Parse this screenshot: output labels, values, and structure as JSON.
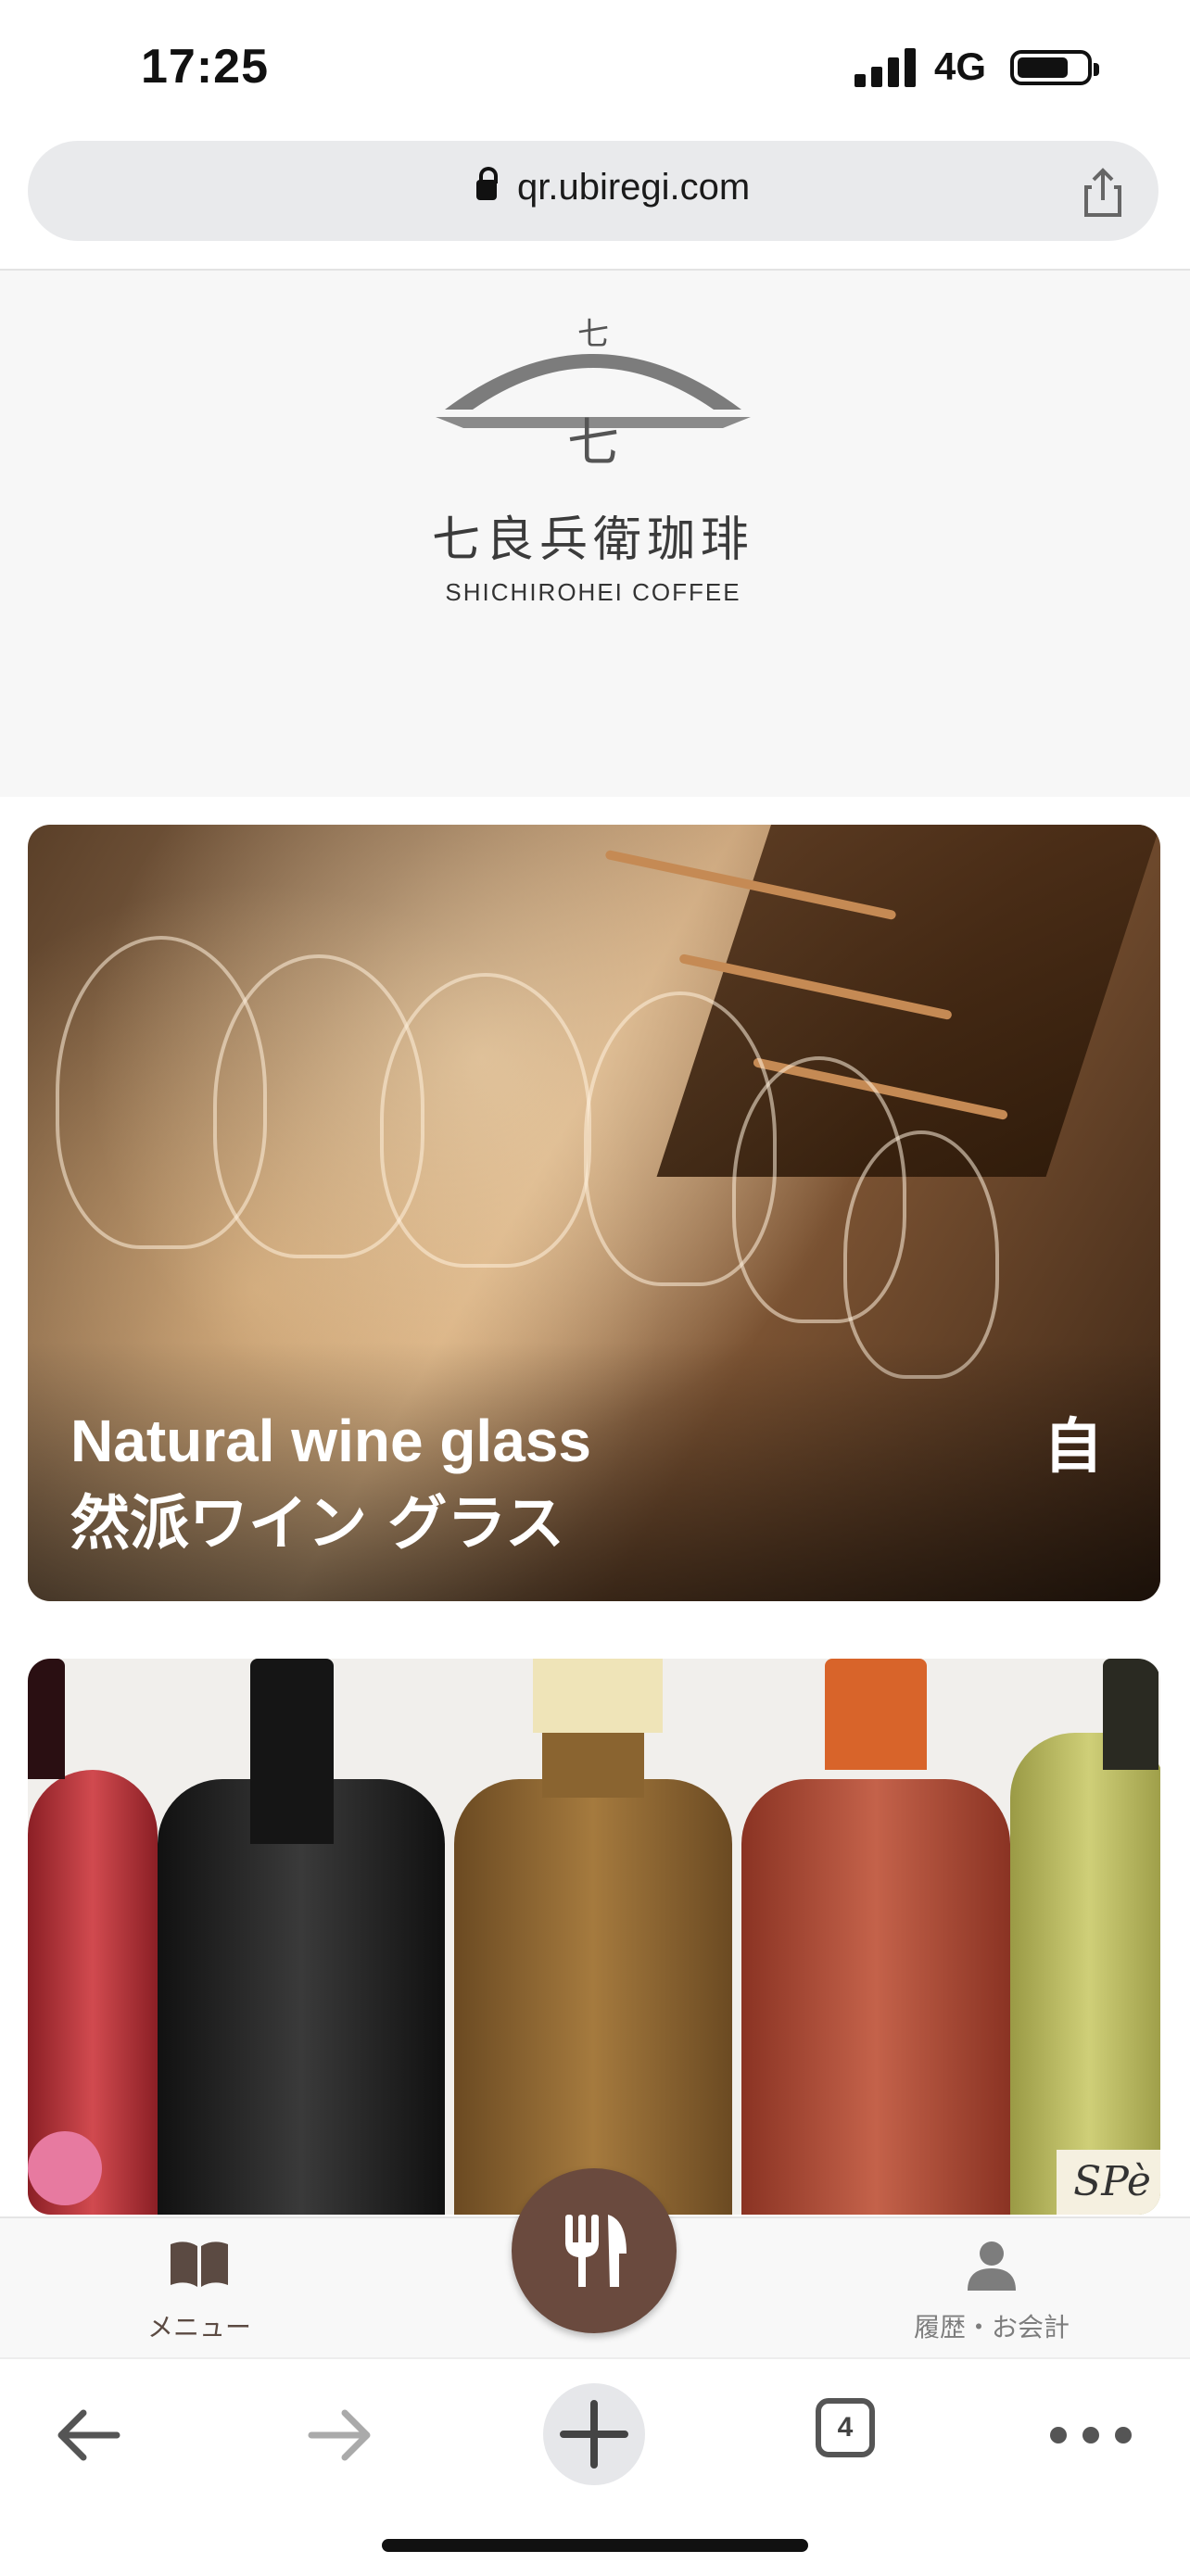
{
  "status_bar": {
    "time": "17:25",
    "network": "4G"
  },
  "browser": {
    "url": "qr.ubiregi.com",
    "open_tabs": "4"
  },
  "store": {
    "logo_kanji": "七良兵衛珈琲",
    "logo_roman": "SHICHIROHEI COFFEE"
  },
  "cards": [
    {
      "title_en": "Natural wine glass",
      "title_ja": "然派ワイン グラス",
      "side_char": "自"
    },
    {
      "label_text": "SPè"
    }
  ],
  "tabbar": {
    "menu_label": "メニュー",
    "bill_label": "履歴・お会計"
  },
  "colors": {
    "accent_brown": "#6a4a3e",
    "menu_icon": "#5b4a42"
  }
}
